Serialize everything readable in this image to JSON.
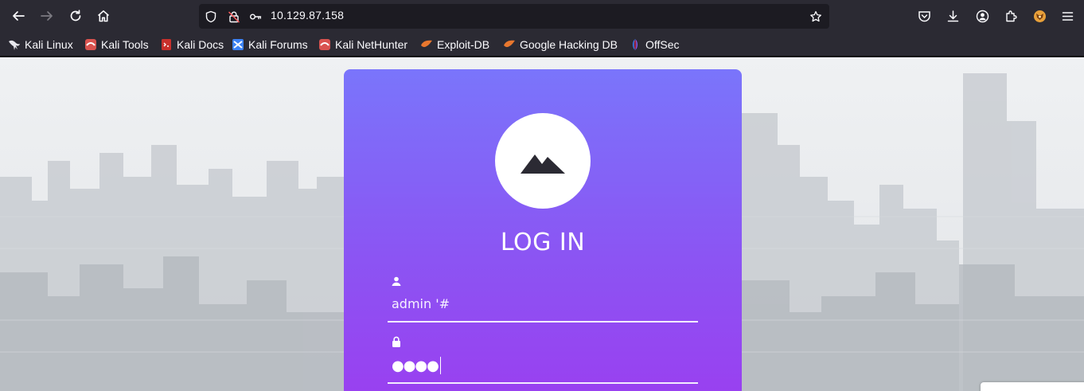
{
  "browser": {
    "url": "10.129.87.158",
    "bookmarks": [
      {
        "label": "Kali Linux",
        "icon": "kali-dragon-icon"
      },
      {
        "label": "Kali Tools",
        "icon": "kali-tools-icon"
      },
      {
        "label": "Kali Docs",
        "icon": "kali-docs-icon"
      },
      {
        "label": "Kali Forums",
        "icon": "kali-forums-icon"
      },
      {
        "label": "Kali NetHunter",
        "icon": "kali-nethunter-icon"
      },
      {
        "label": "Exploit-DB",
        "icon": "exploit-db-icon"
      },
      {
        "label": "Google Hacking DB",
        "icon": "ghdb-icon"
      },
      {
        "label": "OffSec",
        "icon": "offsec-icon"
      }
    ]
  },
  "login": {
    "title": "LOG IN",
    "username_value": "admin '#",
    "password_mask": "●●●●"
  },
  "colors": {
    "chrome_bg": "#2b2a33",
    "urlbar_bg": "#1c1b22",
    "card_top": "#7a75fb",
    "card_bottom": "#9a3ff0",
    "text_light": "#fbfbfe"
  }
}
